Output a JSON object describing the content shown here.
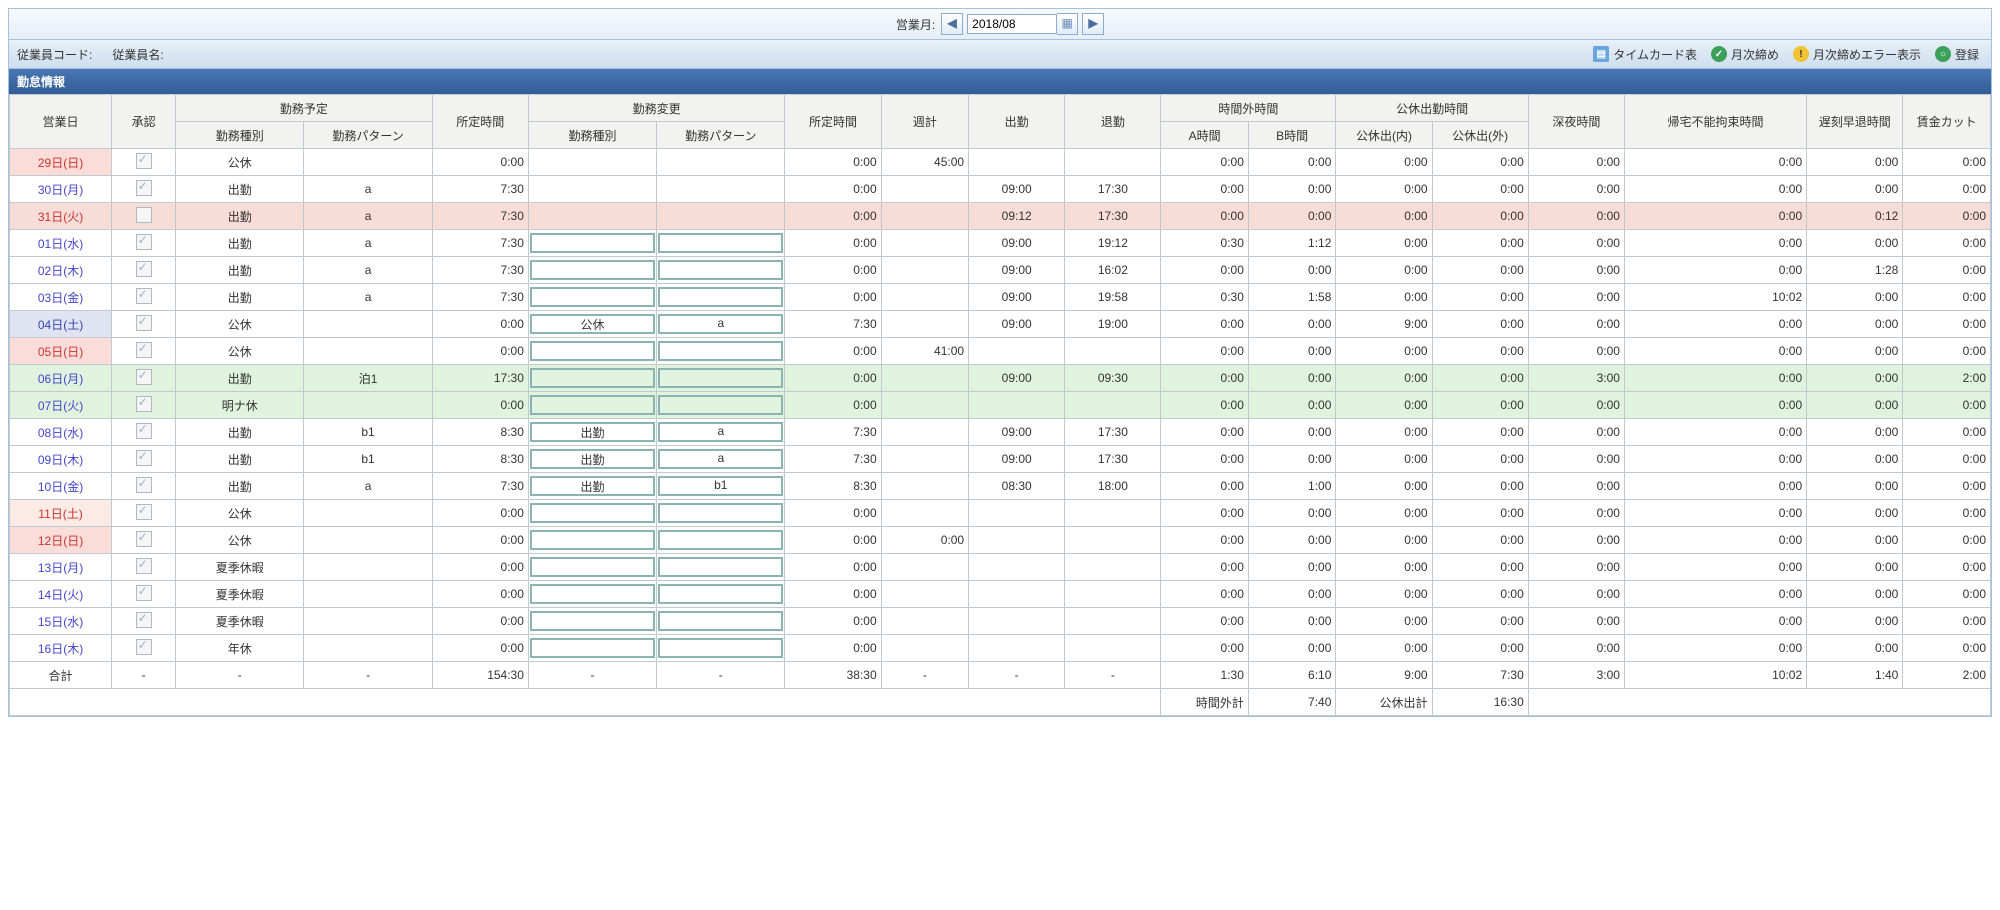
{
  "top": {
    "label": "営業月:",
    "month": "2018/08"
  },
  "sub": {
    "empcode": "従業員コード:",
    "empname": "従業員名:",
    "btn_timecard": "タイムカード表",
    "btn_monthly": "月次締め",
    "btn_err": "月次締めエラー表示",
    "btn_reg": "登録"
  },
  "title": "勤怠情報",
  "hdr": {
    "date": "営業日",
    "ok": "承認",
    "plan": "勤務予定",
    "plan1": "勤務種別",
    "plan2": "勤務パターン",
    "fix1": "所定時間",
    "chg": "勤務変更",
    "chg1": "勤務種別",
    "chg2": "勤務パターン",
    "fix2": "所定時間",
    "week": "週計",
    "in": "出勤",
    "out": "退勤",
    "ot": "時間外時間",
    "otA": "A時間",
    "otB": "B時間",
    "hol": "公休出勤時間",
    "holI": "公休出(内)",
    "holO": "公休出(外)",
    "night": "深夜時間",
    "nogo": "帰宅不能拘束時間",
    "late": "遅刻早退時間",
    "cut": "賃金カット"
  },
  "rows": [
    {
      "date": "29日(日)",
      "cls": "d-sun",
      "ck": 1,
      "type": "公休",
      "pat": "",
      "fix": "0:00",
      "cin": 0,
      "c1": "",
      "c2": "",
      "fix2": "0:00",
      "week": "45:00",
      "in": "",
      "out": "",
      "a": "0:00",
      "b": "0:00",
      "hi": "0:00",
      "ho": "0:00",
      "ng": "0:00",
      "nogo": "0:00",
      "late": "0:00",
      "cut": "0:00"
    },
    {
      "date": "30日(月)",
      "cls": "d-blue",
      "ck": 1,
      "type": "出勤",
      "pat": "a",
      "fix": "7:30",
      "cin": 0,
      "c1": "",
      "c2": "",
      "fix2": "0:00",
      "week": "",
      "in": "09:00",
      "out": "17:30",
      "a": "0:00",
      "b": "0:00",
      "hi": "0:00",
      "ho": "0:00",
      "ng": "0:00",
      "nogo": "0:00",
      "late": "0:00",
      "cut": "0:00"
    },
    {
      "date": "31日(火)",
      "cls": "d-red",
      "row": "hl-pink",
      "ck": 0,
      "type": "出勤",
      "pat": "a",
      "fix": "7:30",
      "cin": 0,
      "c1": "",
      "c2": "",
      "fix2": "0:00",
      "week": "",
      "in": "09:12",
      "out": "17:30",
      "a": "0:00",
      "b": "0:00",
      "hi": "0:00",
      "ho": "0:00",
      "ng": "0:00",
      "nogo": "0:00",
      "late": "0:12",
      "cut": "0:00"
    },
    {
      "date": "01日(水)",
      "cls": "d-blue",
      "ck": 1,
      "type": "出勤",
      "pat": "a",
      "fix": "7:30",
      "cin": 1,
      "c1": "",
      "c2": "",
      "fix2": "0:00",
      "week": "",
      "in": "09:00",
      "out": "19:12",
      "a": "0:30",
      "b": "1:12",
      "hi": "0:00",
      "ho": "0:00",
      "ng": "0:00",
      "nogo": "0:00",
      "late": "0:00",
      "cut": "0:00"
    },
    {
      "date": "02日(木)",
      "cls": "d-blue",
      "ck": 1,
      "type": "出勤",
      "pat": "a",
      "fix": "7:30",
      "cin": 1,
      "c1": "",
      "c2": "",
      "fix2": "0:00",
      "week": "",
      "in": "09:00",
      "out": "16:02",
      "a": "0:00",
      "b": "0:00",
      "hi": "0:00",
      "ho": "0:00",
      "ng": "0:00",
      "nogo": "0:00",
      "late": "1:28",
      "cut": "0:00"
    },
    {
      "date": "03日(金)",
      "cls": "d-blue",
      "ck": 1,
      "type": "出勤",
      "pat": "a",
      "fix": "7:30",
      "cin": 1,
      "c1": "",
      "c2": "",
      "fix2": "0:00",
      "week": "",
      "in": "09:00",
      "out": "19:58",
      "a": "0:30",
      "b": "1:58",
      "hi": "0:00",
      "ho": "0:00",
      "ng": "0:00",
      "nogo": "10:02",
      "late": "0:00",
      "cut": "0:00"
    },
    {
      "date": "04日(土)",
      "cls": "d-sat",
      "ck": 1,
      "type": "公休",
      "pat": "",
      "fix": "0:00",
      "cin": 1,
      "c1": "公休",
      "c2": "a",
      "fix2": "7:30",
      "week": "",
      "in": "09:00",
      "out": "19:00",
      "a": "0:00",
      "b": "0:00",
      "hi": "9:00",
      "ho": "0:00",
      "ng": "0:00",
      "nogo": "0:00",
      "late": "0:00",
      "cut": "0:00"
    },
    {
      "date": "05日(日)",
      "cls": "d-sun",
      "ck": 1,
      "type": "公休",
      "pat": "",
      "fix": "0:00",
      "cin": 1,
      "c1": "",
      "c2": "",
      "fix2": "0:00",
      "week": "41:00",
      "in": "",
      "out": "",
      "a": "0:00",
      "b": "0:00",
      "hi": "0:00",
      "ho": "0:00",
      "ng": "0:00",
      "nogo": "0:00",
      "late": "0:00",
      "cut": "0:00"
    },
    {
      "date": "06日(月)",
      "cls": "d-blue",
      "row": "hl-green",
      "ck": 1,
      "type": "出勤",
      "pat": "泊1",
      "fix": "17:30",
      "cin": 1,
      "c1": "",
      "c2": "",
      "fix2": "0:00",
      "week": "",
      "in": "09:00",
      "out": "09:30",
      "a": "0:00",
      "b": "0:00",
      "hi": "0:00",
      "ho": "0:00",
      "ng": "3:00",
      "nogo": "0:00",
      "late": "0:00",
      "cut": "2:00"
    },
    {
      "date": "07日(火)",
      "cls": "d-blue",
      "row": "hl-green",
      "ck": 1,
      "type": "明ナ休",
      "pat": "",
      "fix": "0:00",
      "cin": 1,
      "c1": "",
      "c2": "",
      "fix2": "0:00",
      "week": "",
      "in": "",
      "out": "",
      "a": "0:00",
      "b": "0:00",
      "hi": "0:00",
      "ho": "0:00",
      "ng": "0:00",
      "nogo": "0:00",
      "late": "0:00",
      "cut": "0:00"
    },
    {
      "date": "08日(水)",
      "cls": "d-blue",
      "ck": 1,
      "type": "出勤",
      "pat": "b1",
      "fix": "8:30",
      "cin": 1,
      "c1": "出勤",
      "c2": "a",
      "fix2": "7:30",
      "week": "",
      "in": "09:00",
      "out": "17:30",
      "a": "0:00",
      "b": "0:00",
      "hi": "0:00",
      "ho": "0:00",
      "ng": "0:00",
      "nogo": "0:00",
      "late": "0:00",
      "cut": "0:00"
    },
    {
      "date": "09日(木)",
      "cls": "d-blue",
      "ck": 1,
      "type": "出勤",
      "pat": "b1",
      "fix": "8:30",
      "cin": 1,
      "c1": "出勤",
      "c2": "a",
      "fix2": "7:30",
      "week": "",
      "in": "09:00",
      "out": "17:30",
      "a": "0:00",
      "b": "0:00",
      "hi": "0:00",
      "ho": "0:00",
      "ng": "0:00",
      "nogo": "0:00",
      "late": "0:00",
      "cut": "0:00"
    },
    {
      "date": "10日(金)",
      "cls": "d-blue",
      "ck": 1,
      "type": "出勤",
      "pat": "a",
      "fix": "7:30",
      "cin": 1,
      "c1": "出勤",
      "c2": "b1",
      "fix2": "8:30",
      "week": "",
      "in": "08:30",
      "out": "18:00",
      "a": "0:00",
      "b": "1:00",
      "hi": "0:00",
      "ho": "0:00",
      "ng": "0:00",
      "nogo": "0:00",
      "late": "0:00",
      "cut": "0:00"
    },
    {
      "date": "11日(土)",
      "cls": "d-red",
      "row": "hl-sat",
      "ck": 1,
      "type": "公休",
      "pat": "",
      "fix": "0:00",
      "cin": 1,
      "c1": "",
      "c2": "",
      "fix2": "0:00",
      "week": "",
      "in": "",
      "out": "",
      "a": "0:00",
      "b": "0:00",
      "hi": "0:00",
      "ho": "0:00",
      "ng": "0:00",
      "nogo": "0:00",
      "late": "0:00",
      "cut": "0:00"
    },
    {
      "date": "12日(日)",
      "cls": "d-sun",
      "ck": 1,
      "type": "公休",
      "pat": "",
      "fix": "0:00",
      "cin": 1,
      "c1": "",
      "c2": "",
      "fix2": "0:00",
      "week": "0:00",
      "in": "",
      "out": "",
      "a": "0:00",
      "b": "0:00",
      "hi": "0:00",
      "ho": "0:00",
      "ng": "0:00",
      "nogo": "0:00",
      "late": "0:00",
      "cut": "0:00"
    },
    {
      "date": "13日(月)",
      "cls": "d-blue",
      "ck": 1,
      "type": "夏季休暇",
      "pat": "",
      "fix": "0:00",
      "cin": 1,
      "c1": "",
      "c2": "",
      "fix2": "0:00",
      "week": "",
      "in": "",
      "out": "",
      "a": "0:00",
      "b": "0:00",
      "hi": "0:00",
      "ho": "0:00",
      "ng": "0:00",
      "nogo": "0:00",
      "late": "0:00",
      "cut": "0:00"
    },
    {
      "date": "14日(火)",
      "cls": "d-blue",
      "ck": 1,
      "type": "夏季休暇",
      "pat": "",
      "fix": "0:00",
      "cin": 1,
      "c1": "",
      "c2": "",
      "fix2": "0:00",
      "week": "",
      "in": "",
      "out": "",
      "a": "0:00",
      "b": "0:00",
      "hi": "0:00",
      "ho": "0:00",
      "ng": "0:00",
      "nogo": "0:00",
      "late": "0:00",
      "cut": "0:00"
    },
    {
      "date": "15日(水)",
      "cls": "d-blue",
      "ck": 1,
      "type": "夏季休暇",
      "pat": "",
      "fix": "0:00",
      "cin": 1,
      "c1": "",
      "c2": "",
      "fix2": "0:00",
      "week": "",
      "in": "",
      "out": "",
      "a": "0:00",
      "b": "0:00",
      "hi": "0:00",
      "ho": "0:00",
      "ng": "0:00",
      "nogo": "0:00",
      "late": "0:00",
      "cut": "0:00"
    },
    {
      "date": "16日(木)",
      "cls": "d-blue",
      "ck": 1,
      "type": "年休",
      "pat": "",
      "fix": "0:00",
      "cin": 1,
      "c1": "",
      "c2": "",
      "fix2": "0:00",
      "week": "",
      "in": "",
      "out": "",
      "a": "0:00",
      "b": "0:00",
      "hi": "0:00",
      "ho": "0:00",
      "ng": "0:00",
      "nogo": "0:00",
      "late": "0:00",
      "cut": "0:00"
    }
  ],
  "total": {
    "label": "合計",
    "fix": "154:30",
    "fix2": "38:30",
    "a": "1:30",
    "b": "6:10",
    "hi": "9:00",
    "ho": "7:30",
    "ng": "3:00",
    "nogo": "10:02",
    "late": "1:40",
    "cut": "2:00"
  },
  "tot2": {
    "otlabel": "時間外計",
    "ot": "7:40",
    "hollabel": "公休出計",
    "hol": "16:30"
  }
}
